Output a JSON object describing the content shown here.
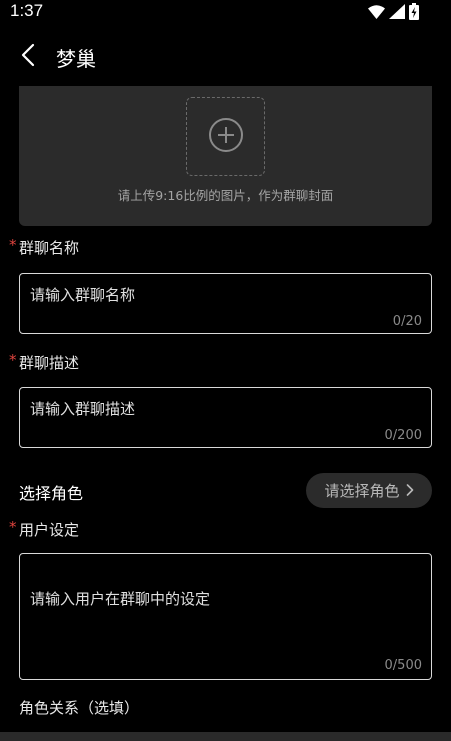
{
  "status_bar": {
    "time": "1:37",
    "icons": [
      "wifi-icon",
      "signal-icon",
      "battery-charging-icon"
    ]
  },
  "header": {
    "back_icon": "chevron-left-icon",
    "title": "梦巢"
  },
  "cover": {
    "upload_icon": "plus-circle-icon",
    "hint": "请上传9:16比例的图片，作为群聊封面"
  },
  "fields": {
    "required_mark": "*",
    "group_name": {
      "label": "群聊名称",
      "placeholder": "请输入群聊名称",
      "counter": "0/20"
    },
    "group_desc": {
      "label": "群聊描述",
      "placeholder": "请输入群聊描述",
      "counter": "0/200"
    },
    "role": {
      "label": "选择角色",
      "button": "请选择角色",
      "chevron_icon": "chevron-right-icon"
    },
    "user_setting": {
      "label": "用户设定",
      "placeholder": "请输入用户在群聊中的设定",
      "counter": "0/500"
    },
    "role_relation": {
      "label": "角色关系（选填）"
    }
  },
  "colors": {
    "background": "#000000",
    "card": "#2b2b2b",
    "required": "#e0443e",
    "border": "#d9d9d9"
  }
}
